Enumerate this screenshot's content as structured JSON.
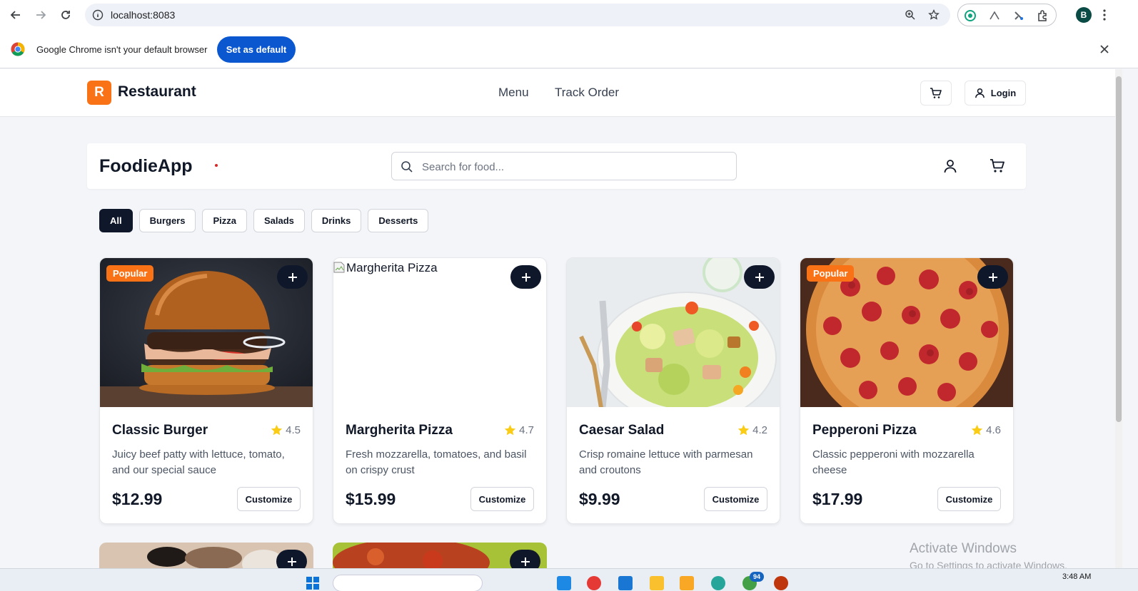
{
  "browser": {
    "url": "localhost:8083",
    "profile_initial": "B",
    "infobar_text": "Google Chrome isn't your default browser",
    "infobar_button": "Set as default"
  },
  "site": {
    "logo_letter": "R",
    "brand": "Restaurant",
    "nav": [
      "Menu",
      "Track Order"
    ],
    "login_label": "Login"
  },
  "app": {
    "title": "FoodieApp",
    "search_placeholder": "Search for food..."
  },
  "filters": [
    "All",
    "Burgers",
    "Pizza",
    "Salads",
    "Drinks",
    "Desserts"
  ],
  "active_filter": "All",
  "products": [
    {
      "name": "Classic Burger",
      "rating": "4.5",
      "description": "Juicy beef patty with lettuce, tomato, and our special sauce",
      "price": "$12.99",
      "badge": "Popular",
      "button": "Customize"
    },
    {
      "name": "Margherita Pizza",
      "rating": "4.7",
      "description": "Fresh mozzarella, tomatoes, and basil on crispy crust",
      "price": "$15.99",
      "alt": "Margherita Pizza",
      "button": "Customize"
    },
    {
      "name": "Caesar Salad",
      "rating": "4.2",
      "description": "Crisp romaine lettuce with parmesan and croutons",
      "price": "$9.99",
      "button": "Customize"
    },
    {
      "name": "Pepperoni Pizza",
      "rating": "4.6",
      "description": "Classic pepperoni with mozzarella cheese",
      "price": "$17.99",
      "badge": "Popular",
      "button": "Customize"
    }
  ],
  "colors": {
    "accent": "#f97316",
    "dark": "#0f172a",
    "star": "#facc15",
    "chrome_blue": "#0b57d0"
  },
  "watermark": {
    "line1": "Activate Windows",
    "line2": "Go to Settings to activate Windows."
  },
  "taskbar": {
    "clock": "3:48 AM",
    "badge": "94"
  }
}
